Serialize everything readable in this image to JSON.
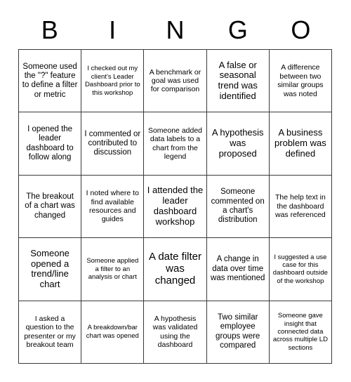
{
  "card": {
    "title": "BINGO",
    "header_letters": [
      "B",
      "I",
      "N",
      "G",
      "O"
    ],
    "grid_size": "5x5",
    "border_color": "#3a3a3a",
    "background_color": "#ffffff",
    "text_color": "#000000"
  },
  "rows": [
    {
      "cells": [
        {
          "text": "Someone used the \"?\" feature to define a filter or metric",
          "size": "m"
        },
        {
          "text": "I checked out my client’s Leader Dashboard prior to this workshop",
          "size": "xs"
        },
        {
          "text": "A benchmark or goal was used for comparison",
          "size": "s"
        },
        {
          "text": "A false or seasonal trend was identified",
          "size": "l"
        },
        {
          "text": "A difference between two similar groups was noted",
          "size": "s"
        }
      ]
    },
    {
      "cells": [
        {
          "text": "I opened the leader dashboard to follow along",
          "size": "m"
        },
        {
          "text": "I commented or contributed to discussion",
          "size": "m"
        },
        {
          "text": "Someone added data labels to a chart from the legend",
          "size": "s"
        },
        {
          "text": "A hypothesis was proposed",
          "size": "l"
        },
        {
          "text": "A business problem was defined",
          "size": "l"
        }
      ]
    },
    {
      "cells": [
        {
          "text": "The breakout of a chart was changed",
          "size": "m"
        },
        {
          "text": "I noted where to find available resources and guides",
          "size": "s"
        },
        {
          "text": "I attended the leader dashboard workshop",
          "size": "l"
        },
        {
          "text": "Someone commented on a chart's distribution",
          "size": "m"
        },
        {
          "text": "The help text in the dashboard was referenced",
          "size": "s"
        }
      ]
    },
    {
      "cells": [
        {
          "text": "Someone opened a trend/line chart",
          "size": "l"
        },
        {
          "text": "Someone applied a filter to an analysis or chart",
          "size": "xs"
        },
        {
          "text": "A date filter was changed",
          "size": "xl"
        },
        {
          "text": "A change in data over time was mentioned",
          "size": "m"
        },
        {
          "text": "I suggested a use case for this dashboard outside of the workshop",
          "size": "xs"
        }
      ]
    },
    {
      "cells": [
        {
          "text": "I asked a question to the presenter or my breakout team",
          "size": "s"
        },
        {
          "text": "A breakdown/bar chart was opened",
          "size": "xs"
        },
        {
          "text": "A hypothesis was validated using the dashboard",
          "size": "s"
        },
        {
          "text": "Two similar employee groups were compared",
          "size": "m"
        },
        {
          "text": "Someone gave insight that connected data across multiple LD sections",
          "size": "xs"
        }
      ]
    }
  ]
}
